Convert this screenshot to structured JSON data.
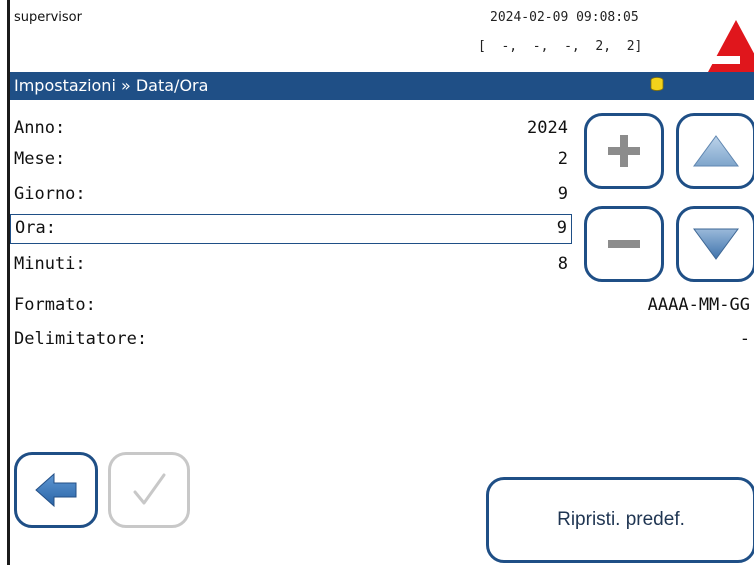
{
  "header": {
    "user": "supervisor",
    "datetime": "2024-02-09 09:08:05",
    "status": "[  -,  -,  -,  2,  2]"
  },
  "titlebar": {
    "breadcrumb": "Impostazioni » Data/Ora",
    "icon": "database-icon"
  },
  "fields": [
    {
      "label": "Anno:",
      "value": "2024"
    },
    {
      "label": "Mese:",
      "value": "2"
    },
    {
      "label": "Giorno:",
      "value": "9"
    },
    {
      "label": "Ora:",
      "value": "9"
    },
    {
      "label": "Minuti:",
      "value": "8"
    },
    {
      "label": "Formato:",
      "value": "AAAA-MM-GG"
    },
    {
      "label": "Delimitatore:",
      "value": "-"
    }
  ],
  "controls": {
    "increase": "plus-icon",
    "decrease": "minus-icon",
    "up": "arrow-up-icon",
    "down": "arrow-down-icon"
  },
  "footer": {
    "back": "arrow-left-icon",
    "confirm": "checkmark-icon",
    "reset_label": "Ripristi. predef."
  },
  "colors": {
    "accent": "#1f4f86",
    "logo": "#e0161c",
    "db_icon": "#f2d21b",
    "disabled": "#c8c8c8"
  }
}
